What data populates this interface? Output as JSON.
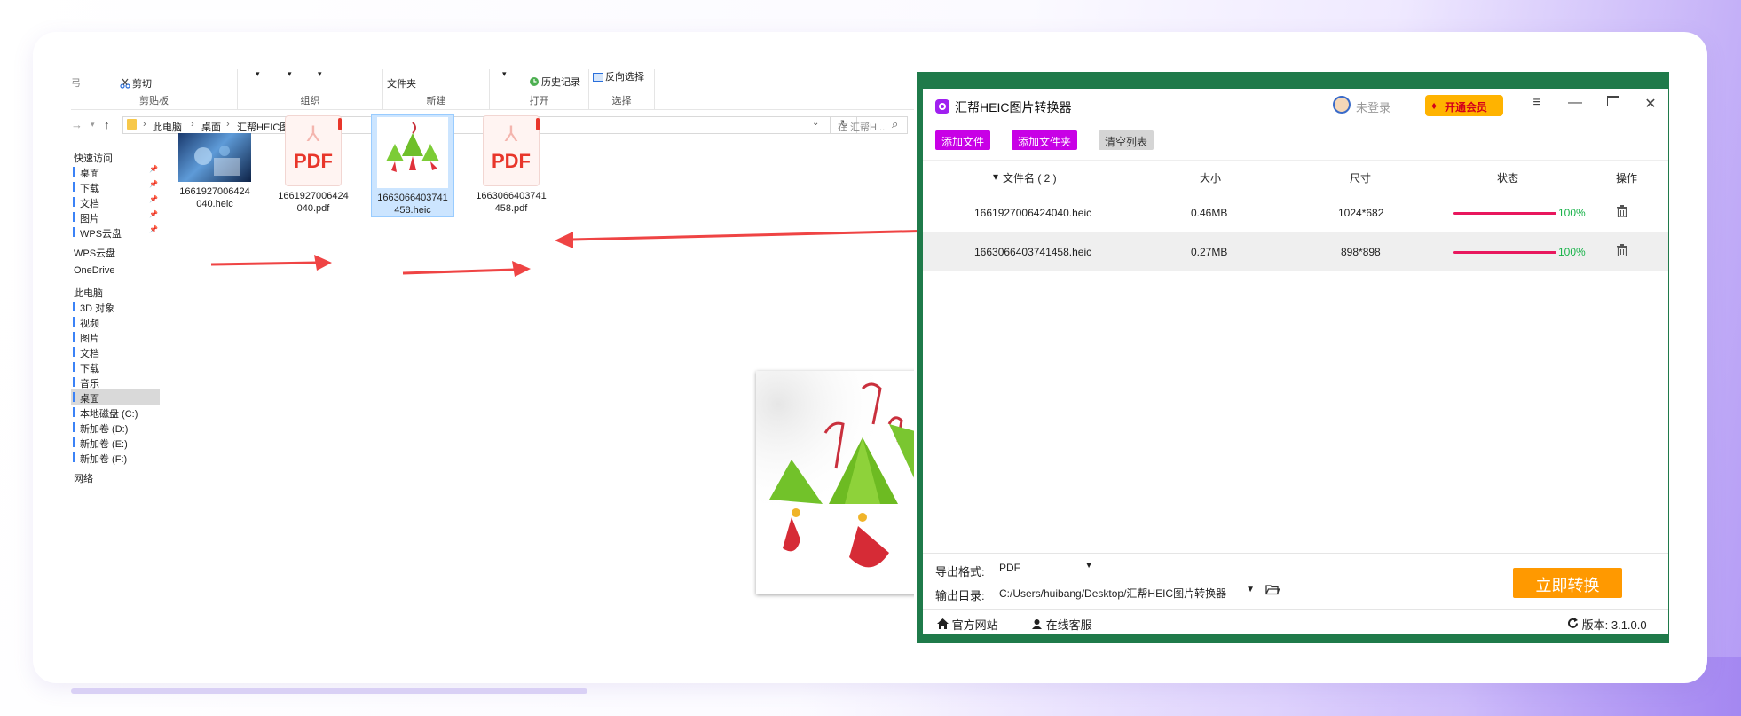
{
  "explorer": {
    "ribbon": {
      "clipboard_item": "剪切",
      "clipboard_group": "剪贴板",
      "organize_group": "组织",
      "new_item": "文件夹",
      "new_group": "新建",
      "history_item": "历史记录",
      "open_group": "打开",
      "invert_item": "反向选择",
      "select_group": "选择"
    },
    "breadcrumb": [
      "此电脑",
      "桌面",
      "汇帮HEIC图片转换器"
    ],
    "search_placeholder": "在 汇帮H...",
    "nav": [
      {
        "label": "快速访问",
        "pinned": false,
        "mark": false
      },
      {
        "label": "桌面",
        "pinned": true,
        "mark": true
      },
      {
        "label": "下载",
        "pinned": true,
        "mark": true
      },
      {
        "label": "文档",
        "pinned": true,
        "mark": true
      },
      {
        "label": "图片",
        "pinned": true,
        "mark": true
      },
      {
        "label": "WPS云盘",
        "pinned": true,
        "mark": true
      },
      {
        "label": "WPS云盘",
        "pinned": false,
        "mark": false
      },
      {
        "label": "OneDrive",
        "pinned": false,
        "mark": false
      },
      {
        "label": "此电脑",
        "pinned": false,
        "mark": false
      },
      {
        "label": "3D 对象",
        "pinned": false,
        "mark": true
      },
      {
        "label": "视频",
        "pinned": false,
        "mark": true
      },
      {
        "label": "图片",
        "pinned": false,
        "mark": true
      },
      {
        "label": "文档",
        "pinned": false,
        "mark": true
      },
      {
        "label": "下载",
        "pinned": false,
        "mark": true
      },
      {
        "label": "音乐",
        "pinned": false,
        "mark": true
      },
      {
        "label": "桌面",
        "pinned": false,
        "mark": true,
        "selected": true
      },
      {
        "label": "本地磁盘 (C:)",
        "pinned": false,
        "mark": true
      },
      {
        "label": "新加卷 (D:)",
        "pinned": false,
        "mark": true
      },
      {
        "label": "新加卷 (E:)",
        "pinned": false,
        "mark": true
      },
      {
        "label": "新加卷 (F:)",
        "pinned": false,
        "mark": true
      },
      {
        "label": "网络",
        "pinned": false,
        "mark": false
      }
    ],
    "files": [
      {
        "line1": "1661927006424",
        "line2": "040.heic",
        "kind": "photo",
        "selected": false
      },
      {
        "line1": "1661927006424",
        "line2": "040.pdf",
        "kind": "pdf",
        "selected": false
      },
      {
        "line1": "1663066403741",
        "line2": "458.heic",
        "kind": "zongzi",
        "selected": true
      },
      {
        "line1": "1663066403741",
        "line2": "458.pdf",
        "kind": "pdf",
        "selected": false
      }
    ],
    "pdf_badge": "PDF"
  },
  "converter": {
    "title": "汇帮HEIC图片转换器",
    "login": "未登录",
    "vip": "开通会员",
    "buttons": {
      "add_file": "添加文件",
      "add_folder": "添加文件夹",
      "clear": "清空列表"
    },
    "columns": {
      "name": "文件名 ( 2 )",
      "size": "大小",
      "dimension": "尺寸",
      "status": "状态",
      "action": "操作"
    },
    "rows": [
      {
        "name": "1661927006424040.heic",
        "size": "0.46MB",
        "dimension": "1024*682",
        "progress": 100,
        "progress_label": "100%"
      },
      {
        "name": "1663066403741458.heic",
        "size": "0.27MB",
        "dimension": "898*898",
        "progress": 100,
        "progress_label": "100%"
      }
    ],
    "export_format_label": "导出格式:",
    "export_format_value": "PDF",
    "output_dir_label": "输出目录:",
    "output_dir_value": "C:/Users/huibang/Desktop/汇帮HEIC图片转换器",
    "convert_button": "立即转换",
    "footer": {
      "website": "官方网站",
      "service": "在线客服",
      "version": "版本:  3.1.0.0"
    },
    "colors": {
      "accent_purple": "#c800e6",
      "orange": "#ff9900",
      "progress": "#e8175d",
      "success": "#19b34a",
      "frame_green": "#1f7a4a"
    }
  }
}
